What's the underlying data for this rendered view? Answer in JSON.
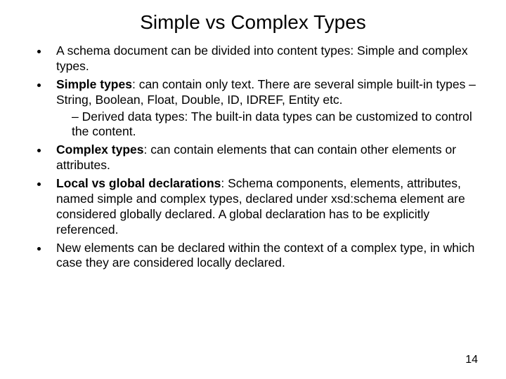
{
  "title": "Simple vs Complex Types",
  "bullets": {
    "b1": "A schema document can be divided into content types: Simple and complex types.",
    "b2_bold": "Simple types",
    "b2_rest": ": can contain only text. There are several simple built-in types – String, Boolean, Float, Double, ID, IDREF, Entity etc.",
    "b2_sub": "Derived data types: The built-in data types can be customized to control the content.",
    "b3_bold": "Complex types",
    "b3_rest": ": can contain elements that can contain other elements or attributes.",
    "b4_bold": "Local vs global declarations",
    "b4_rest": ": Schema components, elements, attributes, named simple and complex types, declared under xsd:schema element are considered globally declared. A global declaration has to be explicitly referenced.",
    "b5": "New elements can be declared within the context of a complex type, in which case they are considered locally declared."
  },
  "page_number": "14"
}
